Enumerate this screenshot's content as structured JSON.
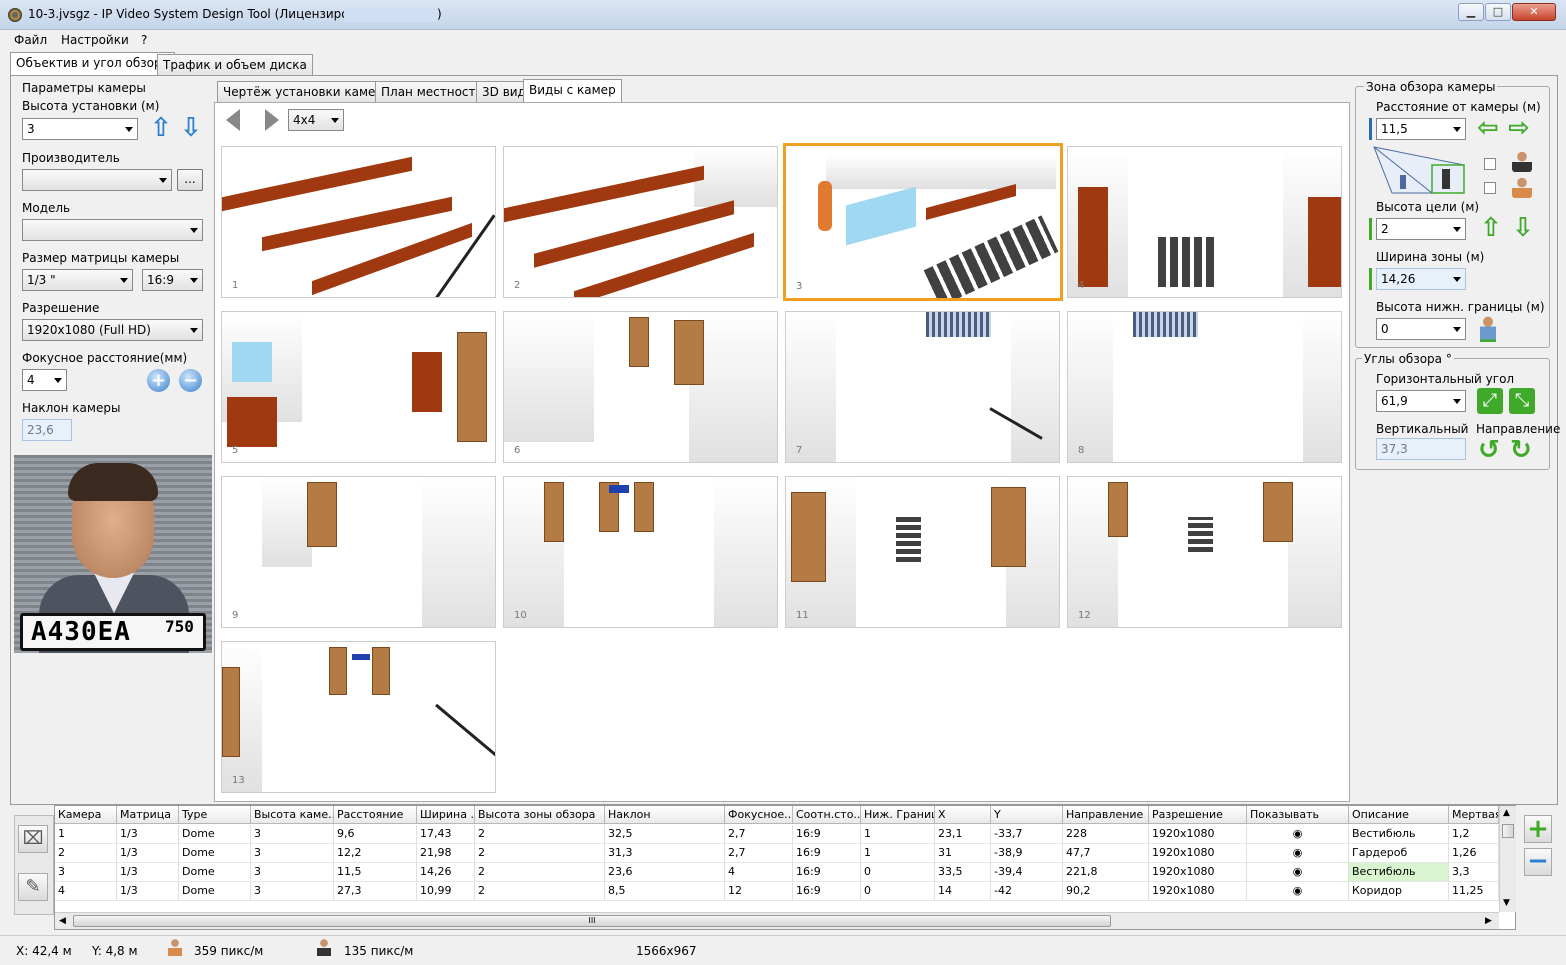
{
  "window": {
    "title": "10-3.jvsgz - IP Video System Design Tool (Лицензировано",
    "title_suffix": ")",
    "minimize": "▁",
    "maximize": "□",
    "close": "✕"
  },
  "menu": [
    "Файл",
    "Настройки",
    "?"
  ],
  "main_tabs": [
    "Объектив и угол обзора",
    "Трафик и объем диска"
  ],
  "left": {
    "camera_params": "Параметры камеры",
    "height_label": "Высота установки (м)",
    "height_value": "3",
    "manufacturer_label": "Производитель",
    "manufacturer_value": "",
    "browse": "...",
    "model_label": "Модель",
    "model_value": "",
    "sensor_label": "Размер матрицы камеры",
    "sensor_value": "1/3 \"",
    "aspect_value": "16:9",
    "resolution_label": "Разрешение",
    "resolution_value": "1920x1080 (Full HD)",
    "focal_label": "Фокусное расстояние(мм)",
    "focal_value": "4",
    "tilt_label": "Наклон камеры",
    "tilt_value": "23,6",
    "plate_text": "А430ЕА",
    "plate_region": "750"
  },
  "view_tabs": [
    "Чертёж установки камеры",
    "План местности",
    "3D вид",
    "Виды с камер"
  ],
  "grid_select": "4x4",
  "thumbnails": [
    "1",
    "2",
    "3",
    "4",
    "5",
    "6",
    "7",
    "8",
    "9",
    "10",
    "11",
    "12",
    "13"
  ],
  "right": {
    "zone_group": "Зона обзора камеры",
    "distance_label": "Расстояние от камеры (м)",
    "distance_value": "11,5",
    "target_height_label": "Высота цели (м)",
    "target_height_value": "2",
    "zone_width_label": "Ширина зоны (м)",
    "zone_width_value": "14,26",
    "lower_bound_label": "Высота нижн. границы (м)",
    "lower_bound_value": "0",
    "angles_group": "Углы обзора °",
    "h_angle_label": "Горизонтальный угол",
    "h_angle_value": "61,9",
    "v_angle_label": "Вертикальный",
    "v_angle_value": "37,3",
    "direction_label": "Направление"
  },
  "table": {
    "columns": [
      "Камера",
      "Матрица",
      "Type",
      "Высота каме...",
      "Расстояние",
      "Ширина ...",
      "Высота зоны обзора",
      "Наклон",
      "Фокусное...",
      "Соотн.сто...",
      "Ниж. Граница",
      "X",
      "Y",
      "Направление",
      "Разрешение",
      "Показывать",
      "Описание",
      "Мертвая"
    ],
    "rows": [
      [
        "1",
        "1/3",
        "Dome",
        "3",
        "9,6",
        "17,43",
        "2",
        "32,5",
        "2,7",
        "16:9",
        "1",
        "23,1",
        "-33,7",
        "228",
        "1920x1080",
        "",
        "Вестибюль",
        "1,2"
      ],
      [
        "2",
        "1/3",
        "Dome",
        "3",
        "12,2",
        "21,98",
        "2",
        "31,3",
        "2,7",
        "16:9",
        "1",
        "31",
        "-38,9",
        "47,7",
        "1920x1080",
        "",
        "Гардероб",
        "1,26"
      ],
      [
        "3",
        "1/3",
        "Dome",
        "3",
        "11,5",
        "14,26",
        "2",
        "23,6",
        "4",
        "16:9",
        "0",
        "33,5",
        "-39,4",
        "221,8",
        "1920x1080",
        "",
        "Вестибюль",
        "3,3"
      ],
      [
        "4",
        "1/3",
        "Dome",
        "3",
        "27,3",
        "10,99",
        "2",
        "8,5",
        "12",
        "16:9",
        "0",
        "14",
        "-42",
        "90,2",
        "1920x1080",
        "",
        "Коридор",
        "11,25"
      ]
    ],
    "scroll_grip": "III"
  },
  "status": {
    "x": "X: 42,4 м",
    "y": "Y: 4,8 м",
    "density1": "359 пикс/м",
    "density2": "135 пикс/м",
    "size": "1566x967"
  },
  "colors": {
    "selected_border": "#f0a020",
    "bench": "#a0390f",
    "door": "#b57b45",
    "green_arrow": "#3faa2a",
    "blue_arrow": "#2f7fd0"
  }
}
